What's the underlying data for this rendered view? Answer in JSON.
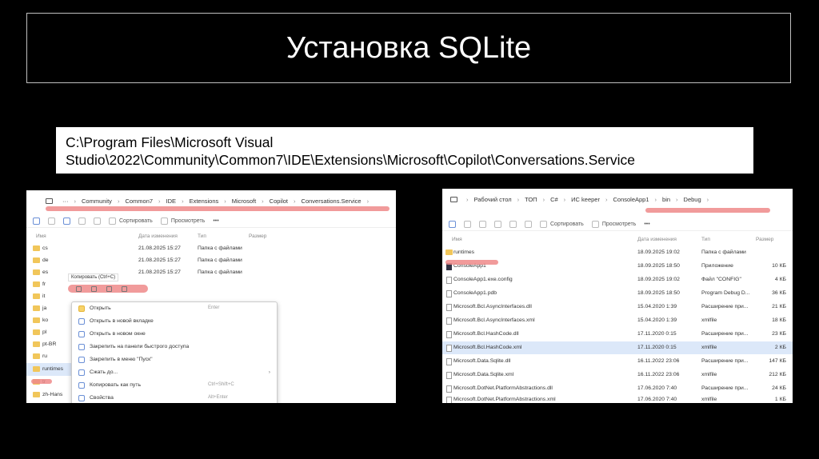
{
  "slide": {
    "title": "Установка SQLite",
    "path_line1": "C:\\Program Files\\Microsoft Visual",
    "path_line2": "Studio\\2022\\Community\\Common7\\IDE\\Extensions\\Microsoft\\Copilot\\Conversations.Service"
  },
  "colors": {
    "background": "#000000",
    "highlight": "#ef8a8a",
    "folder": "#f1c65a",
    "selection": "#dce8f9"
  },
  "left_explorer": {
    "breadcrumbs": [
      "···",
      "Community",
      "Common7",
      "IDE",
      "Extensions",
      "Microsoft",
      "Copilot",
      "Conversations.Service"
    ],
    "toolbar": {
      "sort_label": "Сортировать",
      "view_label": "Просмотреть",
      "more_label": "•••"
    },
    "columns": {
      "name": "Имя",
      "date": "Дата изменения",
      "type": "Тип",
      "size": "Размер"
    },
    "rows": [
      {
        "name": "cs",
        "date": "21.08.2025 15:27",
        "type": "Папка с файлами"
      },
      {
        "name": "de",
        "date": "21.08.2025 15:27",
        "type": "Папка с файлами"
      },
      {
        "name": "es",
        "date": "21.08.2025 15:27",
        "type": "Папка с файлами"
      },
      {
        "name": "fr",
        "date": "",
        "type": ""
      },
      {
        "name": "it",
        "date": "",
        "type": ""
      },
      {
        "name": "ja",
        "date": "",
        "type": ""
      },
      {
        "name": "ko",
        "date": "",
        "type": ""
      },
      {
        "name": "pl",
        "date": "",
        "type": ""
      },
      {
        "name": "pt-BR",
        "date": "",
        "type": ""
      },
      {
        "name": "ru",
        "date": "",
        "type": ""
      },
      {
        "name": "runtimes",
        "date": "",
        "type": ""
      },
      {
        "name": "tr",
        "date": "",
        "type": ""
      },
      {
        "name": "zh-Hans",
        "date": "",
        "type": ""
      }
    ],
    "context_menu": {
      "tooltip": "Копировать (Ctrl+C)",
      "items": [
        {
          "label": "Открыть",
          "shortcut": "Enter"
        },
        {
          "label": "Открыть в новой вкладке",
          "shortcut": ""
        },
        {
          "label": "Открыть в новом окне",
          "shortcut": ""
        },
        {
          "label": "Закрепить на панели быстрого доступа",
          "shortcut": ""
        },
        {
          "label": "Закрепить в меню \"Пуск\"",
          "shortcut": ""
        },
        {
          "label": "Сжать до...",
          "shortcut": "›"
        },
        {
          "label": "Копировать как путь",
          "shortcut": "Ctrl+Shift+C"
        },
        {
          "label": "Свойства",
          "shortcut": "Alt+Enter"
        }
      ]
    }
  },
  "right_explorer": {
    "breadcrumbs": [
      "Рабочий стол",
      "ТОП",
      "C#",
      "ИС keeper",
      "ConsoleApp1",
      "bin",
      "Debug"
    ],
    "toolbar": {
      "sort_label": "Сортировать",
      "view_label": "Просмотреть",
      "more_label": "•••"
    },
    "columns": {
      "name": "Имя",
      "date": "Дата изменения",
      "type": "Тип",
      "size": "Размер"
    },
    "rows": [
      {
        "name": "runtimes",
        "date": "18.09.2025 19:02",
        "type": "Папка с файлами",
        "size": ""
      },
      {
        "name": "ConsoleApp1",
        "date": "18.09.2025 18:50",
        "type": "Приложение",
        "size": "10 КБ"
      },
      {
        "name": "ConsoleApp1.exe.config",
        "date": "18.09.2025 19:02",
        "type": "Файл \"CONFIG\"",
        "size": "4 КБ"
      },
      {
        "name": "ConsoleApp1.pdb",
        "date": "18.09.2025 18:50",
        "type": "Program Debug D...",
        "size": "36 КБ"
      },
      {
        "name": "Microsoft.Bcl.AsyncInterfaces.dll",
        "date": "15.04.2020 1:39",
        "type": "Расширение при...",
        "size": "21 КБ"
      },
      {
        "name": "Microsoft.Bcl.AsyncInterfaces.xml",
        "date": "15.04.2020 1:39",
        "type": "xmlfile",
        "size": "18 КБ"
      },
      {
        "name": "Microsoft.Bcl.HashCode.dll",
        "date": "17.11.2020 0:15",
        "type": "Расширение при...",
        "size": "23 КБ"
      },
      {
        "name": "Microsoft.Bcl.HashCode.xml",
        "date": "17.11.2020 0:15",
        "type": "xmlfile",
        "size": "2 КБ"
      },
      {
        "name": "Microsoft.Data.Sqlite.dll",
        "date": "16.11.2022 23:06",
        "type": "Расширение при...",
        "size": "147 КБ"
      },
      {
        "name": "Microsoft.Data.Sqlite.xml",
        "date": "16.11.2022 23:06",
        "type": "xmlfile",
        "size": "212 КБ"
      },
      {
        "name": "Microsoft.DotNet.PlatformAbstractions.dll",
        "date": "17.06.2020 7:40",
        "type": "Расширение при...",
        "size": "24 КБ"
      },
      {
        "name": "Microsoft.DotNet.PlatformAbstractions.xml",
        "date": "17.06.2020 7:40",
        "type": "xmlfile",
        "size": "1 КБ"
      }
    ]
  }
}
